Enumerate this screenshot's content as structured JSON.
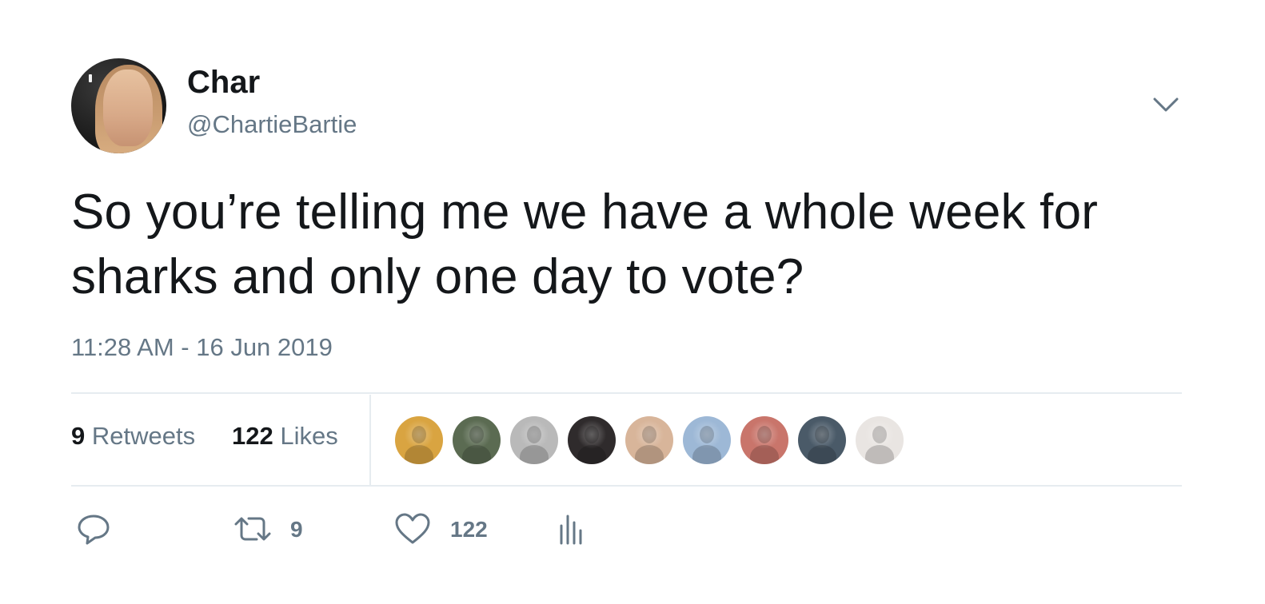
{
  "tweet": {
    "author": {
      "display_name": "Char",
      "handle": "@ChartieBartie"
    },
    "text": "So you’re telling me we have a whole week for sharks and only one day to vote?",
    "timestamp": "11:28 AM - 16 Jun 2019",
    "stats": {
      "retweets_count": "9",
      "retweets_label": "Retweets",
      "likes_count": "122",
      "likes_label": "Likes"
    },
    "likers": [
      {
        "icon": "liker-avatar",
        "color": "#d9a441"
      },
      {
        "icon": "liker-avatar",
        "color": "#5b6b52"
      },
      {
        "icon": "liker-avatar",
        "color": "#b9b9b9"
      },
      {
        "icon": "liker-avatar",
        "color": "#2f2b2c"
      },
      {
        "icon": "liker-avatar",
        "color": "#d8b59a"
      },
      {
        "icon": "liker-avatar",
        "color": "#9db8d6"
      },
      {
        "icon": "liker-avatar",
        "color": "#c9756b"
      },
      {
        "icon": "liker-avatar",
        "color": "#4a5a68"
      },
      {
        "icon": "liker-avatar",
        "color": "#e9e5e2"
      }
    ],
    "actions": {
      "reply_icon": "reply-icon",
      "retweet_icon": "retweet-icon",
      "retweet_count": "9",
      "like_icon": "heart-icon",
      "like_count": "122",
      "analytics_icon": "analytics-icon"
    },
    "colors": {
      "primary_text": "#14171a",
      "secondary_text": "#657786",
      "divider": "#e6ecf0"
    }
  }
}
